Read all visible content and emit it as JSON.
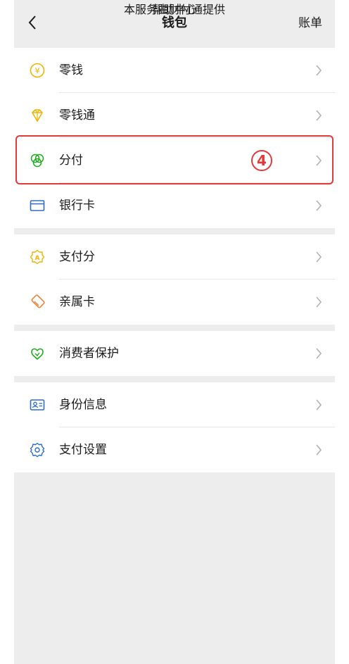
{
  "nav": {
    "title": "钱包",
    "bill_label": "账单"
  },
  "groups": [
    {
      "items": [
        {
          "label": "零钱",
          "icon": "coin-yen-icon"
        },
        {
          "label": "零钱通",
          "icon": "diamond-icon"
        },
        {
          "label": "分付",
          "icon": "fenfu-circles-icon"
        },
        {
          "label": "银行卡",
          "icon": "bank-card-icon"
        }
      ]
    },
    {
      "items": [
        {
          "label": "支付分",
          "icon": "pay-score-badge-icon"
        },
        {
          "label": "亲属卡",
          "icon": "family-card-icon"
        }
      ]
    },
    {
      "items": [
        {
          "label": "消费者保护",
          "icon": "consumer-protection-icon"
        }
      ]
    },
    {
      "items": [
        {
          "label": "身份信息",
          "icon": "id-card-icon"
        },
        {
          "label": "支付设置",
          "icon": "settings-gear-icon"
        }
      ]
    }
  ],
  "annotation": {
    "marker": "4"
  },
  "footer": {
    "help": "帮助中心",
    "provider": "本服务由财付通提供"
  },
  "colors": {
    "background": "#ededed",
    "card": "#ffffff",
    "yellow_icon": "#f0b400",
    "green_icon": "#1aad19",
    "blue_icon": "#2b6cd4",
    "link": "#576b95",
    "annotation_red": "#e23a3a"
  }
}
